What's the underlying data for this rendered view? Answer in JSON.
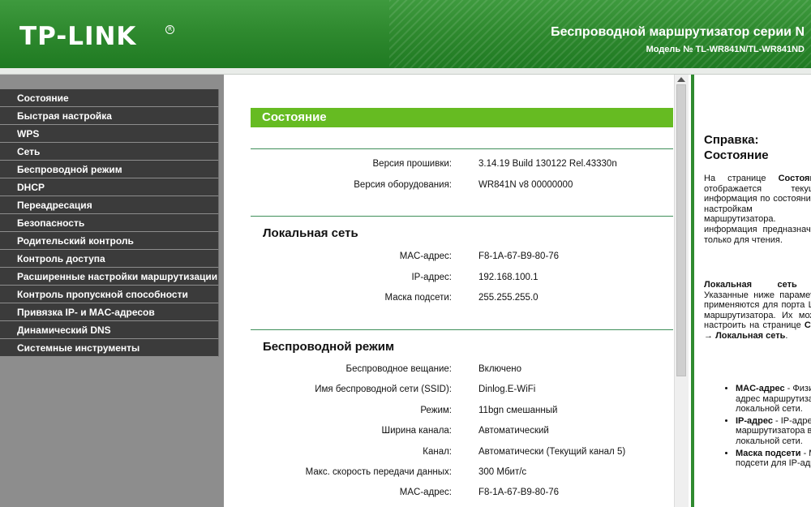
{
  "header": {
    "logo": "TP-LINK",
    "registered": "R",
    "product_title": "Беспроводной маршрутизатор серии N",
    "model_line": "Модель № TL-WR841N/TL-WR841ND"
  },
  "sidebar": {
    "items": [
      {
        "label": "Состояние"
      },
      {
        "label": "Быстрая настройка"
      },
      {
        "label": "WPS"
      },
      {
        "label": "Сеть"
      },
      {
        "label": "Беспроводной режим"
      },
      {
        "label": "DHCP"
      },
      {
        "label": "Переадресация"
      },
      {
        "label": "Безопасность"
      },
      {
        "label": "Родительский контроль"
      },
      {
        "label": "Контроль доступа"
      },
      {
        "label": "Расширенные настройки маршрутизации"
      },
      {
        "label": "Контроль пропускной способности"
      },
      {
        "label": "Привязка IP- и MAC-адресов"
      },
      {
        "label": "Динамический DNS"
      },
      {
        "label": "Системные инструменты"
      }
    ]
  },
  "main": {
    "section_title": "Состояние",
    "firmware": {
      "label": "Версия прошивки:",
      "value": "3.14.19 Build 130122 Rel.43330n"
    },
    "hardware": {
      "label": "Версия оборудования:",
      "value": "WR841N v8 00000000"
    },
    "lan": {
      "title": "Локальная сеть",
      "mac": {
        "label": "MAC-адрес:",
        "value": "F8-1A-67-B9-80-76"
      },
      "ip": {
        "label": "IP-адрес:",
        "value": "192.168.100.1"
      },
      "mask": {
        "label": "Маска подсети:",
        "value": "255.255.255.0"
      }
    },
    "wireless": {
      "title": "Беспроводной режим",
      "broadcast": {
        "label": "Беспроводное вещание:",
        "value": "Включено"
      },
      "ssid": {
        "label": "Имя беспроводной сети (SSID):",
        "value": "Dinlog.E-WiFi"
      },
      "mode": {
        "label": "Режим:",
        "value": "11bgn смешанный"
      },
      "width": {
        "label": "Ширина канала:",
        "value": "Автоматический"
      },
      "channel": {
        "label": "Канал:",
        "value": "Автоматически (Текущий канал 5)"
      },
      "rate": {
        "label": "Макс. скорость передачи данных:",
        "value": "300 Мбит/с"
      },
      "mac": {
        "label": "MAC-адрес:",
        "value": "F8-1A-67-B9-80-76"
      }
    }
  },
  "help": {
    "title_line1": "Справка:",
    "title_line2": "Состояние",
    "intro_prefix": "На странице ",
    "intro_bold": "Состояние",
    "intro_rest": " отображается текущая информация по состоянию и настройкам маршрутизатора. Вся информация предназначена только для чтения.",
    "lan_heading": "Локальная сеть",
    "lan_text_1": " - Указанные ниже параметры применяются для порта LAN маршрутизатора. Их можно настроить на странице ",
    "lan_link_1": "Сеть",
    "lan_text_2": " → ",
    "lan_link_2": "Локальная сеть",
    "lan_text_3": ".",
    "bullets": [
      {
        "term": "MAC-адрес",
        "sep": " - ",
        "desc": "Физический адрес маршрутизатора в локальной сети."
      },
      {
        "term": "IP-адрес",
        "sep": " - ",
        "desc": "IP-адрес маршрутизатора в локальной сети."
      },
      {
        "term": "Маска подсети",
        "sep": " - ",
        "desc": "Маска подсети для IP-адреса."
      }
    ]
  }
}
